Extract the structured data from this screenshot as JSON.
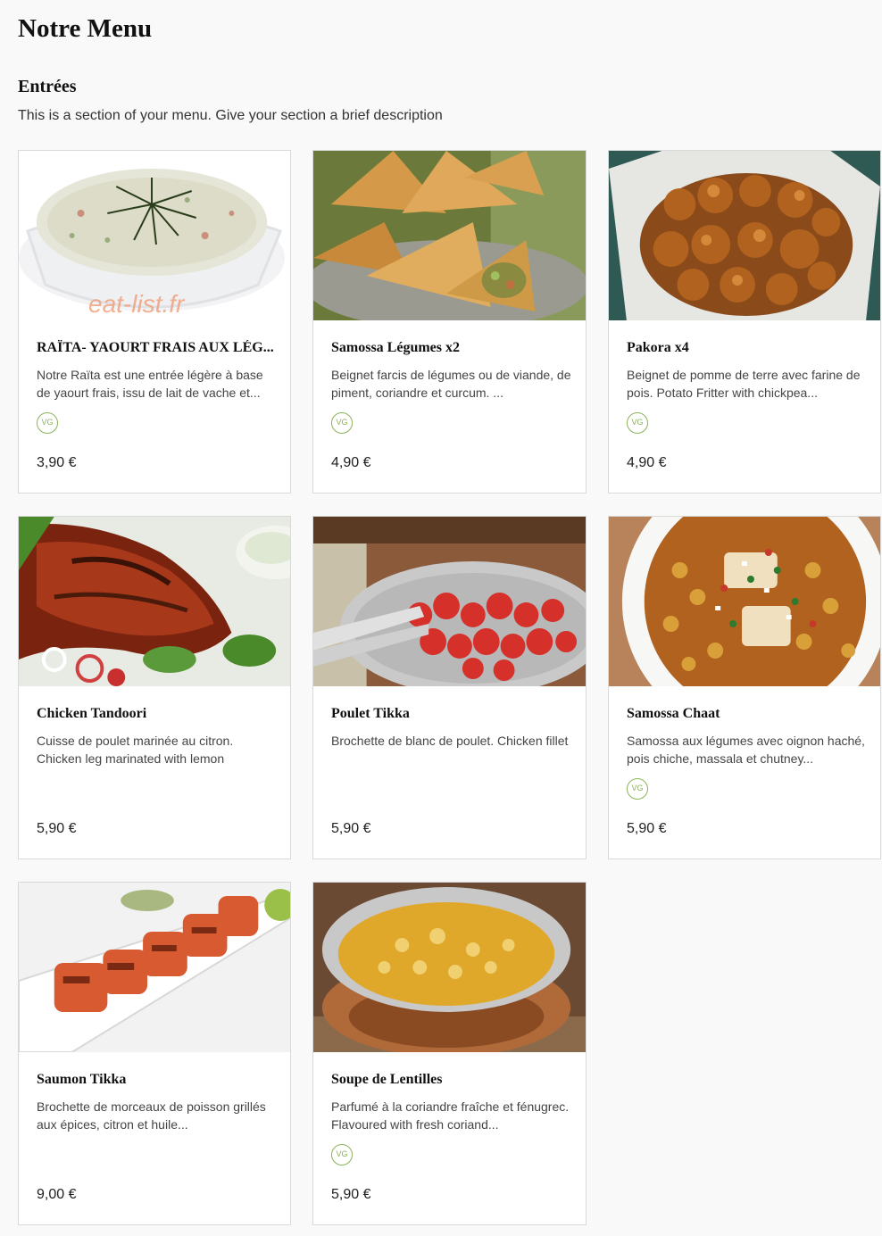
{
  "page": {
    "title": "Notre Menu"
  },
  "section": {
    "title": "Entrées",
    "description": "This is a section of your menu. Give your section a brief description"
  },
  "items": [
    {
      "name": "RAÏTA- YAOURT FRAIS AUX LÉG...",
      "description": "Notre Raïta est une entrée légère à base de yaourt frais, issu de lait de vache et...",
      "price": "3,90 €",
      "badge": "VG",
      "image_icon": "raita-bowl-image",
      "watermark": "eat-list.fr"
    },
    {
      "name": "Samossa Légumes x2",
      "description": "Beignet farcis de légumes ou de viande, de piment, coriandre et curcum. ...",
      "price": "4,90 €",
      "badge": "VG",
      "image_icon": "samossa-image"
    },
    {
      "name": "Pakora x4",
      "description": "Beignet de pomme de terre avec farine de pois.  Potato Fritter with chickpea...",
      "price": "4,90 €",
      "badge": "VG",
      "image_icon": "pakora-image"
    },
    {
      "name": "Chicken Tandoori",
      "description": "Cuisse de poulet marinée au citron. Chicken leg marinated with lemon",
      "price": "5,90 €",
      "badge": "",
      "image_icon": "chicken-tandoori-image"
    },
    {
      "name": "Poulet Tikka",
      "description": "Brochette de blanc de poulet. Chicken fillet",
      "price": "5,90 €",
      "badge": "",
      "image_icon": "poulet-tikka-image"
    },
    {
      "name": "Samossa Chaat",
      "description": "Samossa aux légumes avec oignon haché, pois chiche, massala et chutney...",
      "price": "5,90 €",
      "badge": "VG",
      "image_icon": "samossa-chaat-image"
    },
    {
      "name": "Saumon Tikka",
      "description": "Brochette de morceaux de poisson grillés aux épices, citron et huile...",
      "price": "9,00 €",
      "badge": "",
      "image_icon": "saumon-tikka-image"
    },
    {
      "name": "Soupe de Lentilles",
      "description": "Parfumé à la coriandre fraîche et fénugrec. Flavoured with fresh coriand...",
      "price": "5,90 €",
      "badge": "VG",
      "image_icon": "lentil-soup-image"
    }
  ],
  "colors": {
    "background": "#f9f9f9",
    "card_border": "#d9d9d9",
    "vg_badge": "#8bb25a"
  }
}
